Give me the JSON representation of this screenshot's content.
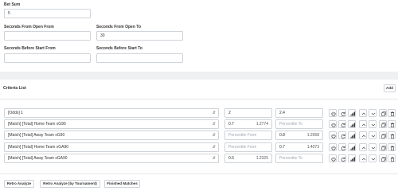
{
  "filters": {
    "bet_sum": {
      "label": "Bet Sum",
      "value": "5"
    },
    "seconds_from_open_from": {
      "label": "Seconds From Open From",
      "value": ""
    },
    "seconds_from_open_to": {
      "label": "Seconds From Open To",
      "value": "30"
    },
    "seconds_before_start_from": {
      "label": "Seconds Before Start From",
      "value": ""
    },
    "seconds_before_start_to": {
      "label": "Seconds Before Start To",
      "value": ""
    }
  },
  "criteria": {
    "title": "Criteria List",
    "add_label": "Add",
    "rows": [
      {
        "field": "[Odds] 1",
        "from": "2",
        "from_hint": "",
        "to": "2.4",
        "to_hint": ""
      },
      {
        "field": "[Match] [Total] Home Team xG90",
        "from": "0.7",
        "from_hint": "1.2774",
        "to": "",
        "to_hint": ""
      },
      {
        "field": "[Match] [Total] Away Team xG90",
        "from": "",
        "from_hint": "",
        "to": "0.8",
        "to_hint": "1.2058"
      },
      {
        "field": "[Match] [Total] Home Team xGA90",
        "from": "",
        "from_hint": "",
        "to": "0.7",
        "to_hint": "1.4073"
      },
      {
        "field": "[Match] [Total] Away Team xGA90",
        "from": "0.6",
        "from_hint": "1.2325",
        "to": "",
        "to_hint": ""
      }
    ],
    "placeholders": {
      "from": "Percentile From",
      "to": "Percentile To"
    }
  },
  "footer": {
    "retro_analyze": "Retro Analyze",
    "retro_analyze_tournament": "Retro Analyze (by Tournament)",
    "finished_matches": "Finished Matches"
  },
  "icons": [
    "power-icon",
    "refresh-icon",
    "bar-chart-icon",
    "chevron-up-icon",
    "chevron-down-icon",
    "copy-icon",
    "trash-icon"
  ]
}
